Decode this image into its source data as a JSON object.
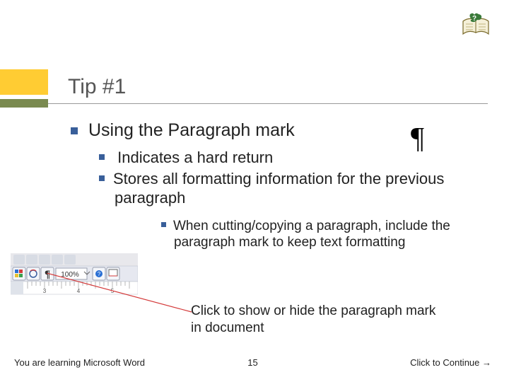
{
  "title": "Tip #1",
  "level1": "Using the Paragraph mark",
  "level2": [
    " Indicates a hard return",
    "Stores all formatting information for the previous paragraph"
  ],
  "level3": "When cutting/copying a paragraph, include the paragraph mark to keep text formatting",
  "callout": "Click to show or hide the paragraph mark in document",
  "footer": {
    "left": "You are learning Microsoft Word",
    "center": "15",
    "right": "Click to Continue →"
  },
  "toolbar": {
    "zoom": "100%",
    "ruler_nums": [
      "3",
      "4",
      "5"
    ]
  }
}
